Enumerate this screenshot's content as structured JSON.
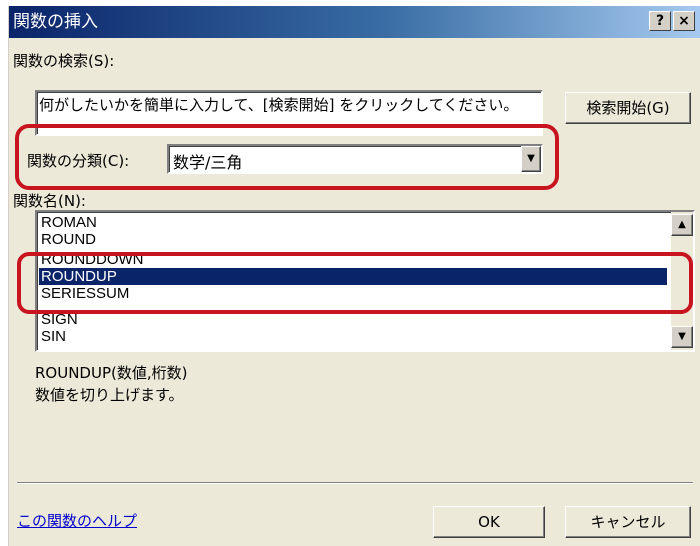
{
  "dialog": {
    "title": "関数の挿入",
    "help_button": "?",
    "close_button": "×"
  },
  "search": {
    "label": "関数の検索(S):",
    "input_value": "何がしたいかを簡単に入力して、[検索開始] をクリックしてください。",
    "button_label": "検索開始(G)"
  },
  "category": {
    "label": "関数の分類(C):",
    "selected": "数学/三角"
  },
  "function_list": {
    "label": "関数名(N):",
    "items": [
      "ROMAN",
      "ROUND",
      "ROUNDDOWN",
      "ROUNDUP",
      "SERIESSUM",
      "SIGN",
      "SIN"
    ],
    "selected": "ROUNDUP"
  },
  "description": {
    "syntax": "ROUNDUP(数値,桁数)",
    "text": "数値を切り上げます。"
  },
  "footer": {
    "help_link": "この関数のヘルプ",
    "ok_label": "OK",
    "cancel_label": "キャンセル"
  },
  "colors": {
    "title_bar": "#0a246a",
    "selection": "#0a246a",
    "highlight_outline": "#c8141e",
    "dialog_bg": "#ece9d8"
  }
}
